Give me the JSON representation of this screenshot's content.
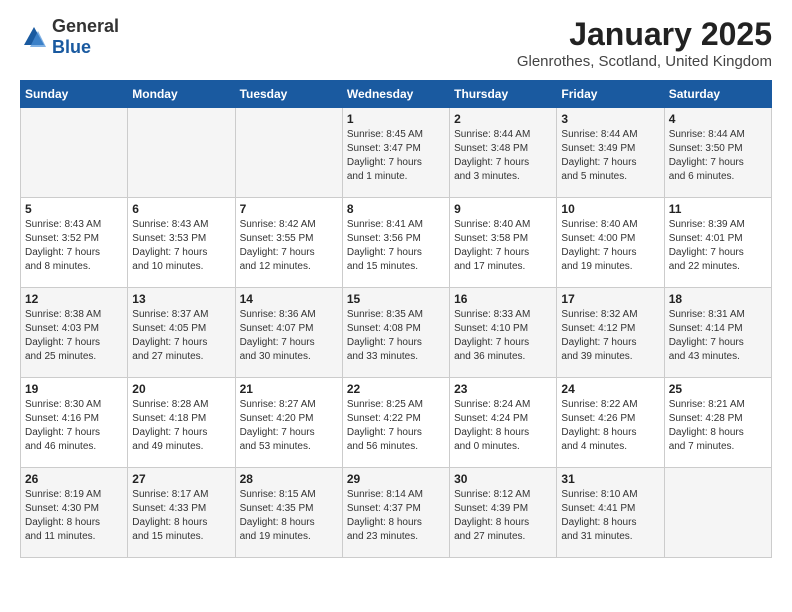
{
  "logo": {
    "general": "General",
    "blue": "Blue"
  },
  "title": "January 2025",
  "subtitle": "Glenrothes, Scotland, United Kingdom",
  "weekdays": [
    "Sunday",
    "Monday",
    "Tuesday",
    "Wednesday",
    "Thursday",
    "Friday",
    "Saturday"
  ],
  "weeks": [
    [
      {
        "day": "",
        "info": ""
      },
      {
        "day": "",
        "info": ""
      },
      {
        "day": "",
        "info": ""
      },
      {
        "day": "1",
        "info": "Sunrise: 8:45 AM\nSunset: 3:47 PM\nDaylight: 7 hours\nand 1 minute."
      },
      {
        "day": "2",
        "info": "Sunrise: 8:44 AM\nSunset: 3:48 PM\nDaylight: 7 hours\nand 3 minutes."
      },
      {
        "day": "3",
        "info": "Sunrise: 8:44 AM\nSunset: 3:49 PM\nDaylight: 7 hours\nand 5 minutes."
      },
      {
        "day": "4",
        "info": "Sunrise: 8:44 AM\nSunset: 3:50 PM\nDaylight: 7 hours\nand 6 minutes."
      }
    ],
    [
      {
        "day": "5",
        "info": "Sunrise: 8:43 AM\nSunset: 3:52 PM\nDaylight: 7 hours\nand 8 minutes."
      },
      {
        "day": "6",
        "info": "Sunrise: 8:43 AM\nSunset: 3:53 PM\nDaylight: 7 hours\nand 10 minutes."
      },
      {
        "day": "7",
        "info": "Sunrise: 8:42 AM\nSunset: 3:55 PM\nDaylight: 7 hours\nand 12 minutes."
      },
      {
        "day": "8",
        "info": "Sunrise: 8:41 AM\nSunset: 3:56 PM\nDaylight: 7 hours\nand 15 minutes."
      },
      {
        "day": "9",
        "info": "Sunrise: 8:40 AM\nSunset: 3:58 PM\nDaylight: 7 hours\nand 17 minutes."
      },
      {
        "day": "10",
        "info": "Sunrise: 8:40 AM\nSunset: 4:00 PM\nDaylight: 7 hours\nand 19 minutes."
      },
      {
        "day": "11",
        "info": "Sunrise: 8:39 AM\nSunset: 4:01 PM\nDaylight: 7 hours\nand 22 minutes."
      }
    ],
    [
      {
        "day": "12",
        "info": "Sunrise: 8:38 AM\nSunset: 4:03 PM\nDaylight: 7 hours\nand 25 minutes."
      },
      {
        "day": "13",
        "info": "Sunrise: 8:37 AM\nSunset: 4:05 PM\nDaylight: 7 hours\nand 27 minutes."
      },
      {
        "day": "14",
        "info": "Sunrise: 8:36 AM\nSunset: 4:07 PM\nDaylight: 7 hours\nand 30 minutes."
      },
      {
        "day": "15",
        "info": "Sunrise: 8:35 AM\nSunset: 4:08 PM\nDaylight: 7 hours\nand 33 minutes."
      },
      {
        "day": "16",
        "info": "Sunrise: 8:33 AM\nSunset: 4:10 PM\nDaylight: 7 hours\nand 36 minutes."
      },
      {
        "day": "17",
        "info": "Sunrise: 8:32 AM\nSunset: 4:12 PM\nDaylight: 7 hours\nand 39 minutes."
      },
      {
        "day": "18",
        "info": "Sunrise: 8:31 AM\nSunset: 4:14 PM\nDaylight: 7 hours\nand 43 minutes."
      }
    ],
    [
      {
        "day": "19",
        "info": "Sunrise: 8:30 AM\nSunset: 4:16 PM\nDaylight: 7 hours\nand 46 minutes."
      },
      {
        "day": "20",
        "info": "Sunrise: 8:28 AM\nSunset: 4:18 PM\nDaylight: 7 hours\nand 49 minutes."
      },
      {
        "day": "21",
        "info": "Sunrise: 8:27 AM\nSunset: 4:20 PM\nDaylight: 7 hours\nand 53 minutes."
      },
      {
        "day": "22",
        "info": "Sunrise: 8:25 AM\nSunset: 4:22 PM\nDaylight: 7 hours\nand 56 minutes."
      },
      {
        "day": "23",
        "info": "Sunrise: 8:24 AM\nSunset: 4:24 PM\nDaylight: 8 hours\nand 0 minutes."
      },
      {
        "day": "24",
        "info": "Sunrise: 8:22 AM\nSunset: 4:26 PM\nDaylight: 8 hours\nand 4 minutes."
      },
      {
        "day": "25",
        "info": "Sunrise: 8:21 AM\nSunset: 4:28 PM\nDaylight: 8 hours\nand 7 minutes."
      }
    ],
    [
      {
        "day": "26",
        "info": "Sunrise: 8:19 AM\nSunset: 4:30 PM\nDaylight: 8 hours\nand 11 minutes."
      },
      {
        "day": "27",
        "info": "Sunrise: 8:17 AM\nSunset: 4:33 PM\nDaylight: 8 hours\nand 15 minutes."
      },
      {
        "day": "28",
        "info": "Sunrise: 8:15 AM\nSunset: 4:35 PM\nDaylight: 8 hours\nand 19 minutes."
      },
      {
        "day": "29",
        "info": "Sunrise: 8:14 AM\nSunset: 4:37 PM\nDaylight: 8 hours\nand 23 minutes."
      },
      {
        "day": "30",
        "info": "Sunrise: 8:12 AM\nSunset: 4:39 PM\nDaylight: 8 hours\nand 27 minutes."
      },
      {
        "day": "31",
        "info": "Sunrise: 8:10 AM\nSunset: 4:41 PM\nDaylight: 8 hours\nand 31 minutes."
      },
      {
        "day": "",
        "info": ""
      }
    ]
  ]
}
